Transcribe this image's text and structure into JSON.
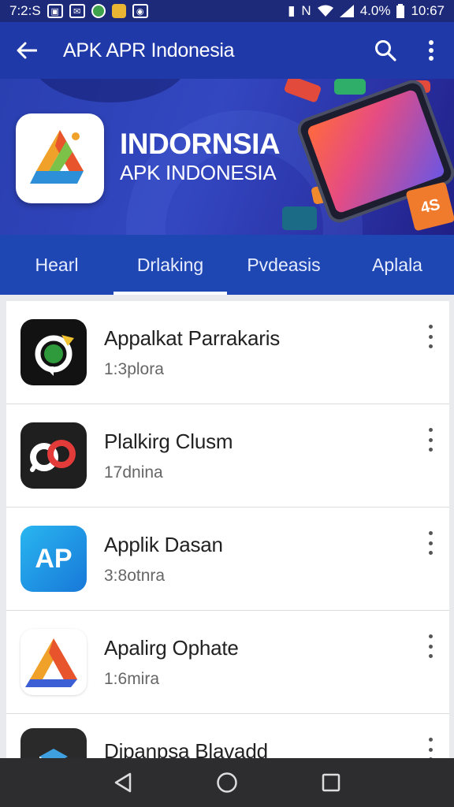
{
  "status_bar": {
    "time_left": "7:2:S",
    "battery": "4.0%",
    "time_right": "10:67"
  },
  "app_bar": {
    "title": "APK APR Indonesia"
  },
  "banner": {
    "title": "INDORNSIA",
    "subtitle": "APK INDONESIA",
    "badge": "4S"
  },
  "tabs": [
    {
      "label": "Hearl"
    },
    {
      "label": "Drlaking"
    },
    {
      "label": "Pvdeasis"
    },
    {
      "label": "Aplala"
    }
  ],
  "apps": [
    {
      "title": "Appalkat Parrakaris",
      "subtitle": "1:3plora",
      "icon": "camera-app-icon"
    },
    {
      "title": "Plalkirg Clusm",
      "subtitle": "17dnina",
      "icon": "infinity-app-icon"
    },
    {
      "title": "Applik Dasan",
      "subtitle": "3:8otnra",
      "icon": "ap-app-icon",
      "icon_text": "AP"
    },
    {
      "title": "Apalirg Ophate",
      "subtitle": "1:6mira",
      "icon": "triangle-app-icon"
    },
    {
      "title": "Dipanpsa Blavadd",
      "subtitle": "",
      "icon": "cube-app-icon"
    }
  ],
  "colors": {
    "status_bar": "#1d2a7a",
    "app_bar": "#2039a8",
    "tab_bar": "#1f47b3",
    "nav_bar": "#2d2d2f"
  }
}
